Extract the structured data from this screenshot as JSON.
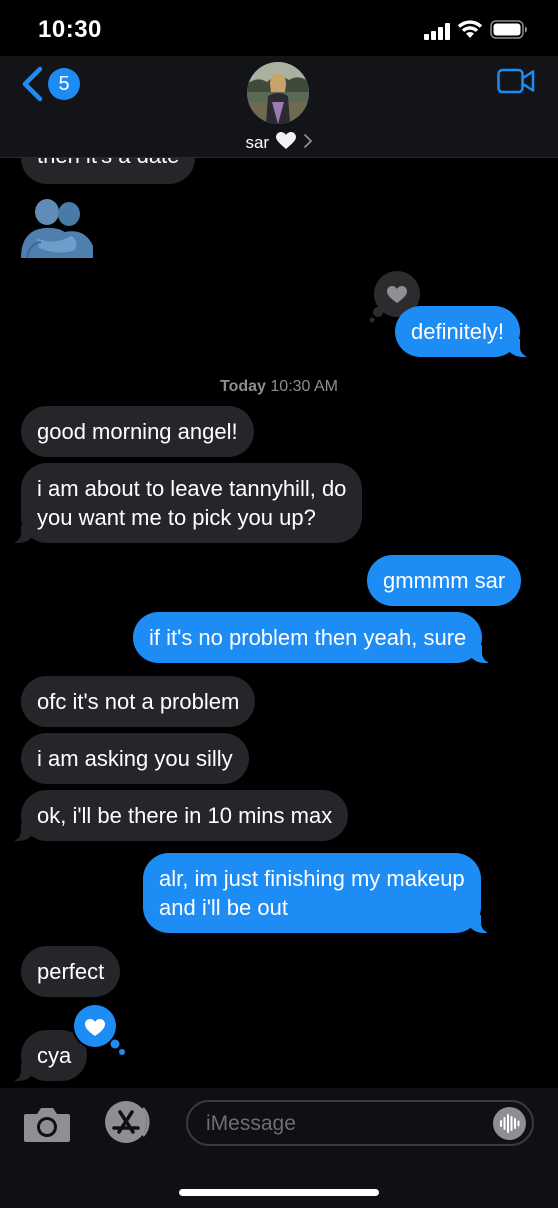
{
  "status": {
    "time": "10:30"
  },
  "nav": {
    "back_count": "5",
    "contact_name": "sar",
    "contact_emoji": "white-heart"
  },
  "messages": {
    "m0": "then it's a date",
    "m1_emoji": "people-hugging",
    "m2": "definitely!",
    "timestamp_day": "Today",
    "timestamp_time": "10:30 AM",
    "m3": "good morning angel!",
    "m4_line1": "i am about to leave tannyhill, do",
    "m4_line2": "you want me to pick you up?",
    "m5": "gmmmm sar",
    "m6": "if it's no problem then yeah, sure",
    "m7": "ofc it's not a problem",
    "m8": "i am asking you silly",
    "m9": "ok, i'll be there in 10 mins max",
    "m10_line1": "alr, im just finishing my makeup",
    "m10_line2": "and i'll be out",
    "m11": "perfect",
    "m12": "cya"
  },
  "tapbacks": {
    "on_definitely": "heart",
    "on_cya": "heart"
  },
  "input": {
    "placeholder": "iMessage"
  },
  "colors": {
    "sent_bubble": "#1e8cf5",
    "received_bubble": "#26252a",
    "background": "#000000"
  }
}
